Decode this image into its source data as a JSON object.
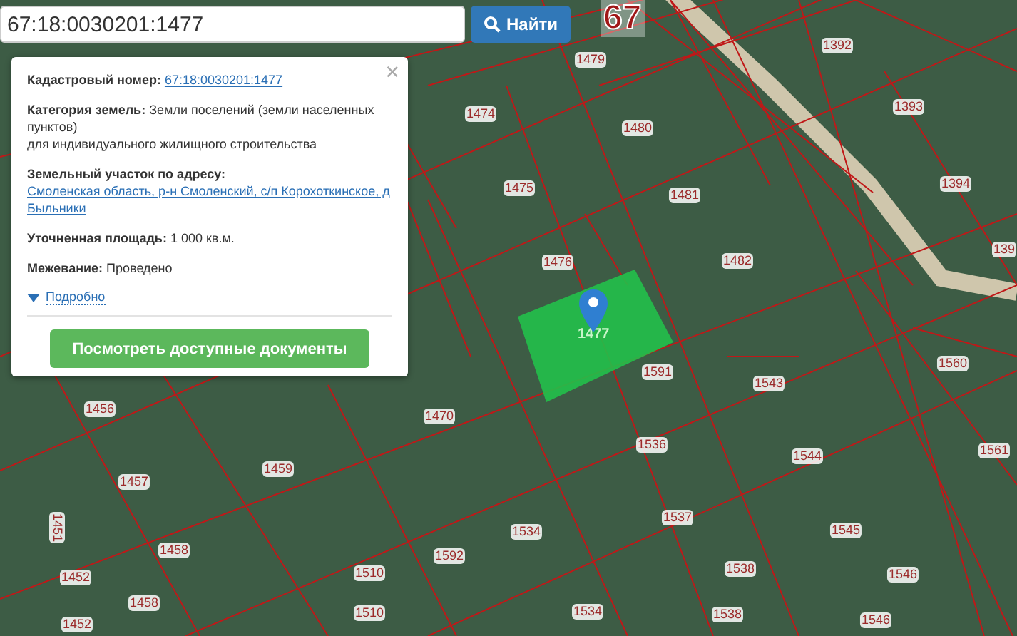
{
  "search": {
    "value": "67:18:0030201:1477",
    "button": "Найти"
  },
  "popup": {
    "close": "×",
    "fields": [
      {
        "kind": "link",
        "label": "Кадастровый номер:",
        "value": "67:18:0030201:1477"
      },
      {
        "kind": "text",
        "label": "Категория земель:",
        "value": "Земли поселений (земли населенных пунктов)",
        "extra": "для индивидуального жилищного строительства"
      },
      {
        "kind": "link",
        "label": "Земельный участок по адресу:",
        "value": "Смоленская область, р-н Смоленский, с/п Корохоткинское, д Быльники"
      },
      {
        "kind": "text",
        "label": "Уточненная площадь:",
        "value": "1 000 кв.м."
      },
      {
        "kind": "text",
        "label": "Межевание:",
        "value": "Проведено"
      }
    ],
    "more": {
      "label": "Подробно",
      "expanded": false
    },
    "button": "Посмотреть доступные документы"
  },
  "map": {
    "selected_parcel": "1477",
    "district": "67",
    "labels": [
      {
        "text": "1479"
      },
      {
        "text": "1392"
      },
      {
        "text": "1474"
      },
      {
        "text": "1480"
      },
      {
        "text": "1393"
      },
      {
        "text": "1475"
      },
      {
        "text": "1481"
      },
      {
        "text": "1394"
      },
      {
        "text": "1476"
      },
      {
        "text": "1482"
      },
      {
        "text": "139"
      },
      {
        "text": "1591"
      },
      {
        "text": "1543"
      },
      {
        "text": "1560"
      },
      {
        "text": "1456"
      },
      {
        "text": "1470"
      },
      {
        "text": "1536"
      },
      {
        "text": "1544"
      },
      {
        "text": "1561"
      },
      {
        "text": "1457"
      },
      {
        "text": "1459"
      },
      {
        "text": "1451"
      },
      {
        "text": "1534"
      },
      {
        "text": "1537"
      },
      {
        "text": "1545"
      },
      {
        "text": "1458"
      },
      {
        "text": "1592"
      },
      {
        "text": "1452"
      },
      {
        "text": "1510"
      },
      {
        "text": "1538"
      },
      {
        "text": "1546"
      },
      {
        "text": "1458"
      },
      {
        "text": "1452"
      },
      {
        "text": "1510"
      },
      {
        "text": "1534"
      },
      {
        "text": "1538"
      },
      {
        "text": "1546"
      }
    ]
  }
}
